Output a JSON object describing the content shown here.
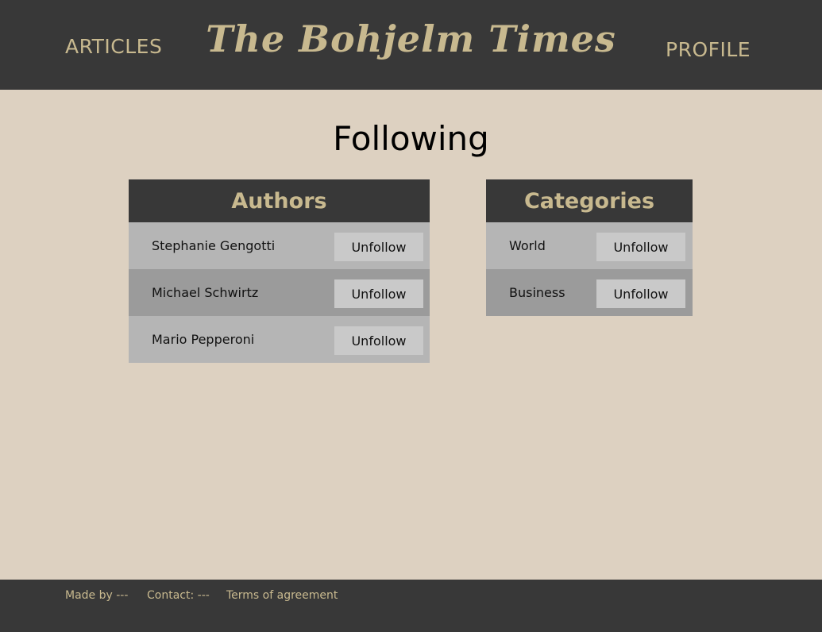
{
  "header": {
    "nav_articles": "ARTICLES",
    "title": "The Bohjelm Times",
    "nav_profile": "PROFILE"
  },
  "main": {
    "heading": "Following",
    "authors": {
      "title": "Authors",
      "items": [
        {
          "name": "Stephanie Gengotti",
          "button": "Unfollow"
        },
        {
          "name": "Michael Schwirtz",
          "button": "Unfollow"
        },
        {
          "name": "Mario Pepperoni",
          "button": "Unfollow"
        }
      ]
    },
    "categories": {
      "title": "Categories",
      "items": [
        {
          "name": "World",
          "button": "Unfollow"
        },
        {
          "name": "Business",
          "button": "Unfollow"
        }
      ]
    }
  },
  "footer": {
    "made_by": "Made by ---",
    "contact": "Contact: ---",
    "terms": "Terms of agreement"
  },
  "colors": {
    "header_bg": "#383838",
    "accent_gold": "#c8b98f",
    "page_bg": "#ddd1c1",
    "row_light": "#b5b5b5",
    "row_dark": "#9b9b9b",
    "button_bg": "#c9c9c9"
  }
}
